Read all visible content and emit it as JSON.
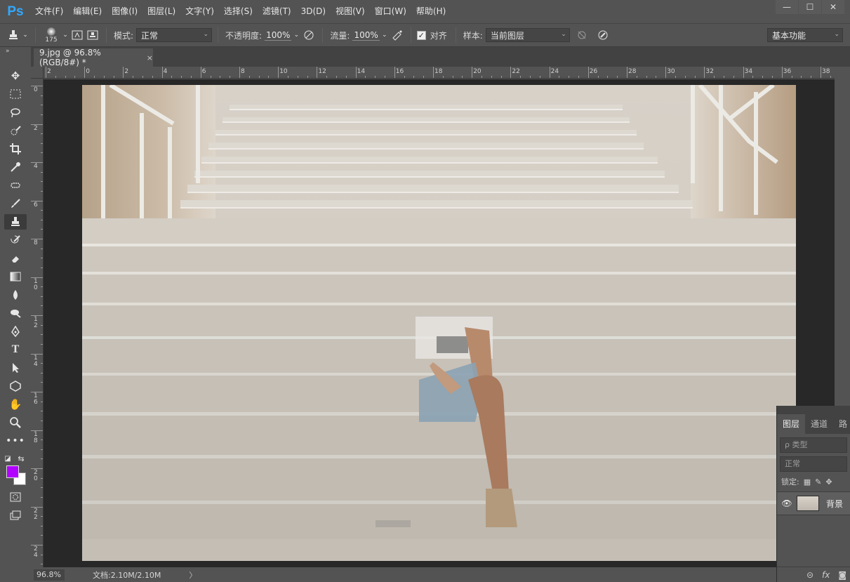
{
  "app": {
    "logo": "Ps"
  },
  "menu": [
    "文件(F)",
    "编辑(E)",
    "图像(I)",
    "图层(L)",
    "文字(Y)",
    "选择(S)",
    "滤镜(T)",
    "3D(D)",
    "视图(V)",
    "窗口(W)",
    "帮助(H)"
  ],
  "window_controls": {
    "minimize": "—",
    "maximize": "☐",
    "close": "✕"
  },
  "options": {
    "brush_size": "175",
    "mode_label": "模式:",
    "mode_value": "正常",
    "opacity_label": "不透明度:",
    "opacity_value": "100%",
    "flow_label": "流量:",
    "flow_value": "100%",
    "aligned_label": "对齐",
    "aligned_checked": "✓",
    "sample_label": "样本:",
    "sample_value": "当前图层",
    "workspace": "基本功能"
  },
  "tab": {
    "title": "9.jpg @ 96.8%(RGB/8#) *",
    "close": "×"
  },
  "ruler_top": [
    "2",
    "0",
    "2",
    "4",
    "6",
    "8",
    "10",
    "12",
    "14",
    "16",
    "18",
    "20",
    "22",
    "24",
    "26",
    "28",
    "30",
    "32",
    "34",
    "36",
    "38"
  ],
  "ruler_left": [
    "0",
    "2",
    "4",
    "6",
    "8",
    "1\n0",
    "1\n2",
    "1\n4",
    "1\n6",
    "1\n8",
    "2\n0",
    "2\n2",
    "2\n4"
  ],
  "status": {
    "zoom": "96.8%",
    "doc_info": "文档:2.10M/2.10M",
    "arrow": "〉"
  },
  "layers_panel": {
    "tabs": [
      "图层",
      "通道",
      "路"
    ],
    "kind_filter": "ρ 类型",
    "blend_mode": "正常",
    "lock_label": "锁定:",
    "layer_name": "背景"
  },
  "colors": {
    "foreground": "#b100ff",
    "background": "#ffffff",
    "ui_bg": "#535353",
    "logo": "#31a8ff"
  }
}
